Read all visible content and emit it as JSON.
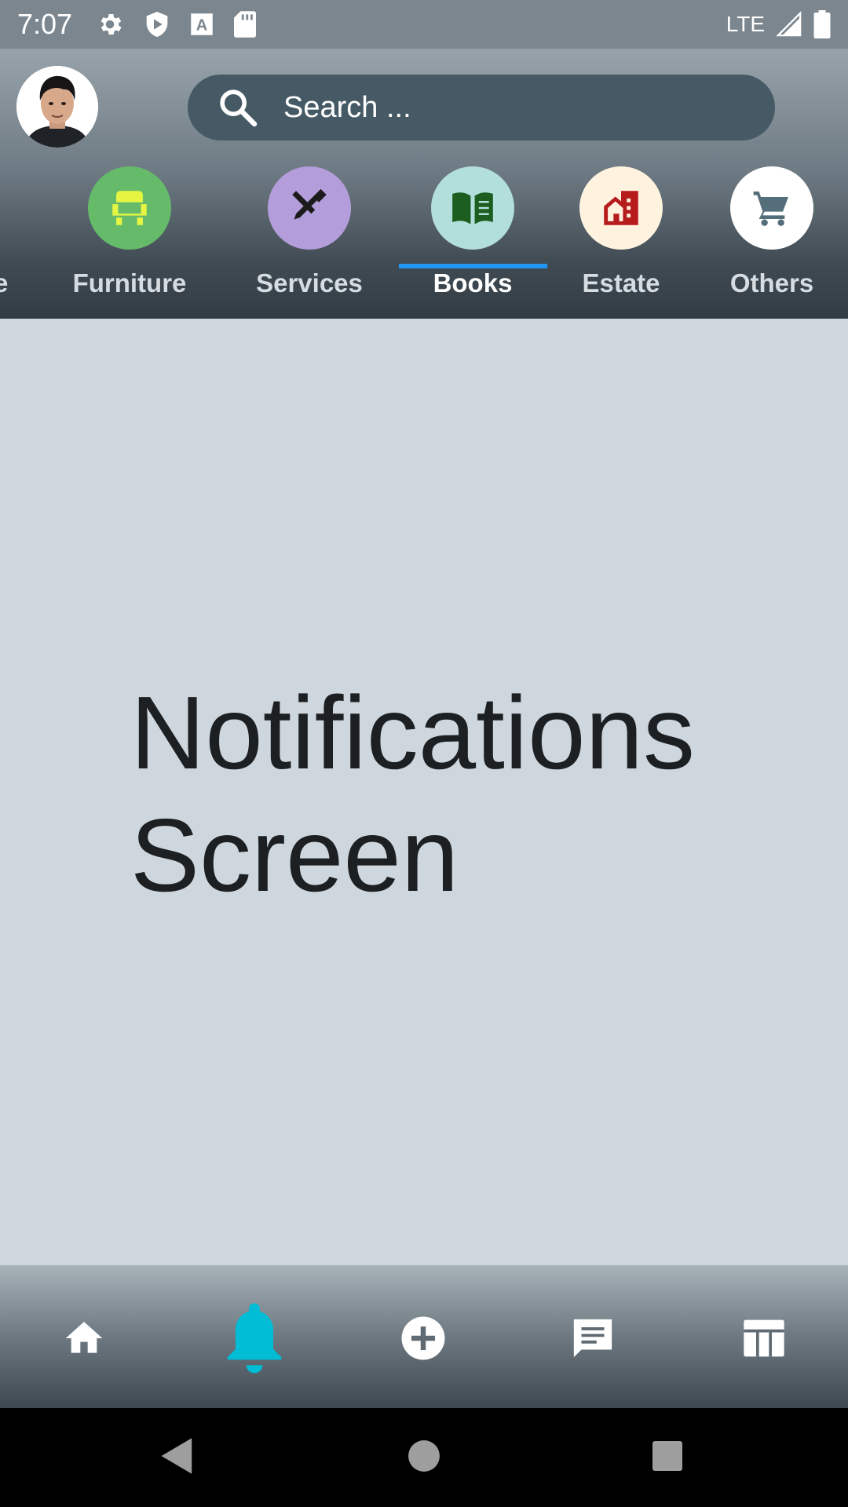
{
  "status_bar": {
    "time": "7:07",
    "network": "LTE",
    "icons": [
      "settings-icon",
      "shield-icon",
      "a-icon",
      "sd-card-icon",
      "signal-icon",
      "battery-icon"
    ]
  },
  "header": {
    "search": {
      "placeholder": "Search ..."
    },
    "categories": [
      {
        "label": "Furniture",
        "icon": "armchair-icon",
        "color": "#66bb6a",
        "icon_color": "#e6f542"
      },
      {
        "label": "Services",
        "icon": "tools-icon",
        "color": "#b39ddb",
        "icon_color": "#1b1b1b"
      },
      {
        "label": "Books",
        "icon": "book-icon",
        "color": "#b2dfdb",
        "icon_color": "#1b5e20",
        "active": true
      },
      {
        "label": "Estate",
        "icon": "house-icon",
        "color": "#fff3e0",
        "icon_color": "#b71c1c"
      },
      {
        "label": "Others",
        "icon": "cart-icon",
        "color": "#ffffff",
        "icon_color": "#546e7a"
      }
    ],
    "partial_label": "e"
  },
  "main": {
    "title": "Notifications Screen"
  },
  "bottom_nav": {
    "items": [
      "home-icon",
      "bell-icon",
      "add-circle-icon",
      "chat-icon",
      "table-icon"
    ],
    "active": "bell-icon",
    "active_color": "#00bcd4"
  },
  "system_nav": [
    "back-icon",
    "home-button-icon",
    "recents-icon"
  ]
}
